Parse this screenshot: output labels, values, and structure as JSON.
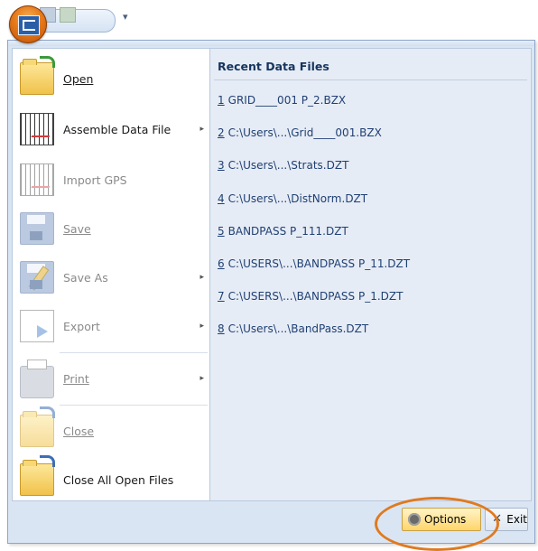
{
  "quick_access": {
    "overflow_glyph": "▾"
  },
  "left_menu": [
    {
      "label": "Open",
      "mnemonic_index": 0,
      "has_submenu": false,
      "enabled": true
    },
    {
      "label": "Assemble Data File",
      "has_submenu": true,
      "enabled": true
    },
    {
      "label": "Import GPS",
      "has_submenu": false,
      "enabled": false
    },
    {
      "label": "Save",
      "has_submenu": false,
      "enabled": false
    },
    {
      "label": "Save As",
      "has_submenu": true,
      "enabled": false
    },
    {
      "label": "Export",
      "has_submenu": true,
      "enabled": false
    },
    {
      "label": "Print",
      "has_submenu": true,
      "enabled": false
    },
    {
      "label": "Close",
      "has_submenu": false,
      "enabled": false
    },
    {
      "label": "Close All Open Files",
      "has_submenu": false,
      "enabled": true
    }
  ],
  "submenu_arrow": "▸",
  "recent": {
    "heading": "Recent Data Files",
    "files": [
      {
        "num": "1",
        "name": "GRID____001 P_2.BZX"
      },
      {
        "num": "2",
        "name": "C:\\Users\\...\\Grid____001.BZX"
      },
      {
        "num": "3",
        "name": "C:\\Users\\...\\Strats.DZT"
      },
      {
        "num": "4",
        "name": "C:\\Users\\...\\DistNorm.DZT"
      },
      {
        "num": "5",
        "name": "BANDPASS P_111.DZT"
      },
      {
        "num": "6",
        "name": "C:\\USERS\\...\\BANDPASS P_11.DZT"
      },
      {
        "num": "7",
        "name": "C:\\USERS\\...\\BANDPASS P_1.DZT"
      },
      {
        "num": "8",
        "name": "C:\\Users\\...\\BandPass.DZT"
      }
    ]
  },
  "buttons": {
    "options": "Options",
    "exit": "Exit"
  },
  "colors": {
    "accent_orange": "#e07a1f",
    "recent_text": "#1f3f73",
    "pane_bg": "#e6ecf5"
  }
}
